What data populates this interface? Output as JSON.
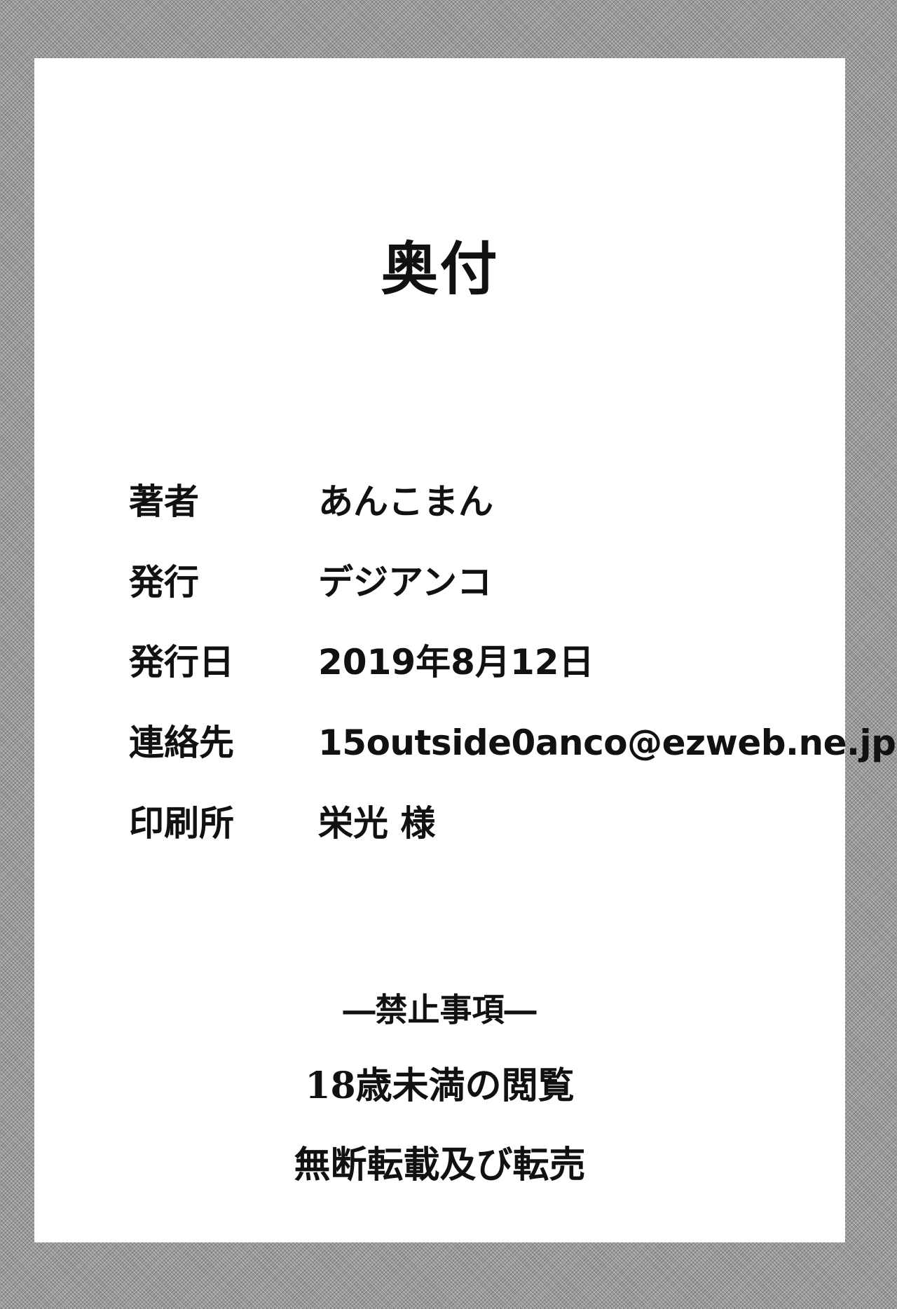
{
  "title": "奥付",
  "colophon": [
    {
      "label": "著者",
      "value": "あんこまん"
    },
    {
      "label": "発行",
      "value": "デジアンコ"
    },
    {
      "label": "発行日",
      "value": "2019年8月12日"
    },
    {
      "label": "連絡先",
      "value": "15outside0anco@ezweb.ne.jp"
    },
    {
      "label": "印刷所",
      "value": "栄光 様"
    }
  ],
  "notice": {
    "heading": "―禁止事項―",
    "items": [
      "18歳未満の閲覧",
      "無断転載及び転売"
    ]
  }
}
